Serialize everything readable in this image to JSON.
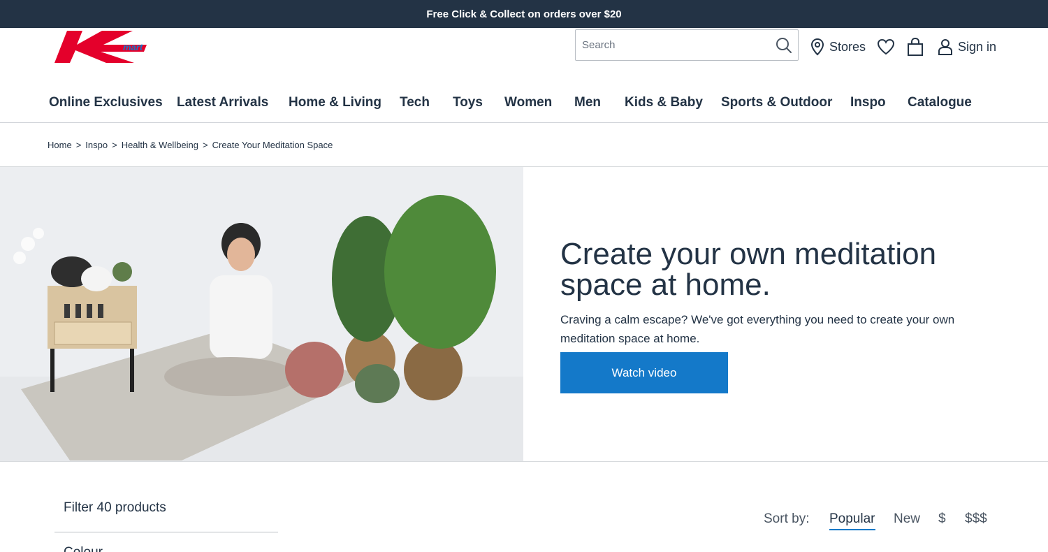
{
  "promo": {
    "text": "Free Click & Collect on orders over $20"
  },
  "brand": {
    "name": "Kmart",
    "wordmark": "mart",
    "red": "#e4002b"
  },
  "search": {
    "placeholder": "Search",
    "icon": "search-icon"
  },
  "utility": {
    "stores_label": "Stores",
    "signin_label": "Sign in"
  },
  "nav": {
    "items": [
      "Online Exclusives",
      "Latest Arrivals",
      "Home & Living",
      "Tech",
      "Toys",
      "Women",
      "Men",
      "Kids & Baby",
      "Sports & Outdoor",
      "Inspo",
      "Catalogue"
    ]
  },
  "breadcrumb": {
    "items": [
      "Home",
      "Inspo",
      "Health & Wellbeing",
      "Create Your Meditation Space"
    ],
    "separator": ">"
  },
  "hero": {
    "title": "Create your own meditation space at home.",
    "subtitle": "Craving a calm escape? We've got everything you need to create your own meditation space at home.",
    "button": "Watch video"
  },
  "filter": {
    "title": "Filter 40 products",
    "next_heading": "Colour"
  },
  "sort": {
    "label": "Sort by:",
    "options": [
      "Popular",
      "New",
      "$",
      "$$$"
    ],
    "active": "Popular"
  },
  "colors": {
    "dark": "#233345",
    "accent_blue": "#1479c9",
    "brand_red": "#e4002b"
  }
}
